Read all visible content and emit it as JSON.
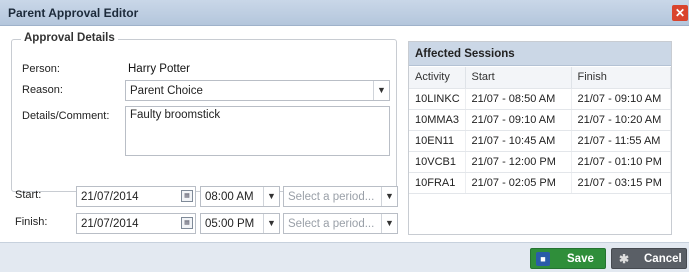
{
  "window": {
    "title": "Parent Approval Editor",
    "close_glyph": "✕"
  },
  "details": {
    "legend": "Approval Details",
    "person_label": "Person:",
    "person_value": "Harry Potter",
    "reason_label": "Reason:",
    "reason_value": "Parent Choice",
    "comment_label": "Details/Comment:",
    "comment_value": "Faulty broomstick"
  },
  "start": {
    "label": "Start:",
    "date": "21/07/2014",
    "time": "08:00 AM",
    "period_placeholder": "Select a period..."
  },
  "finish": {
    "label": "Finish:",
    "date": "21/07/2014",
    "time": "05:00 PM",
    "period_placeholder": "Select a period..."
  },
  "sessions": {
    "title": "Affected Sessions",
    "columns": [
      "Activity",
      "Start",
      "Finish"
    ],
    "rows": [
      [
        "10LINKC",
        "21/07 - 08:50 AM",
        "21/07 - 09:10 AM"
      ],
      [
        "10MMA3",
        "21/07 - 09:10 AM",
        "21/07 - 10:20 AM"
      ],
      [
        "10EN11",
        "21/07 - 10:45 AM",
        "21/07 - 11:55 AM"
      ],
      [
        "10VCB1",
        "21/07 - 12:00 PM",
        "21/07 - 01:10 PM"
      ],
      [
        "10FRA1",
        "21/07 - 02:05 PM",
        "21/07 - 03:15 PM"
      ]
    ]
  },
  "footer": {
    "save_label": "Save",
    "cancel_label": "Cancel"
  },
  "icons": {
    "dropdown": "chevron-down-icon",
    "calendar": "calendar-icon",
    "save": "save-disk-icon",
    "cancel": "cancel-icon"
  },
  "colors": {
    "save": "#2f8e3a",
    "cancel": "#5a5f66",
    "close": "#d9442d",
    "header": "#cbd7e6"
  }
}
